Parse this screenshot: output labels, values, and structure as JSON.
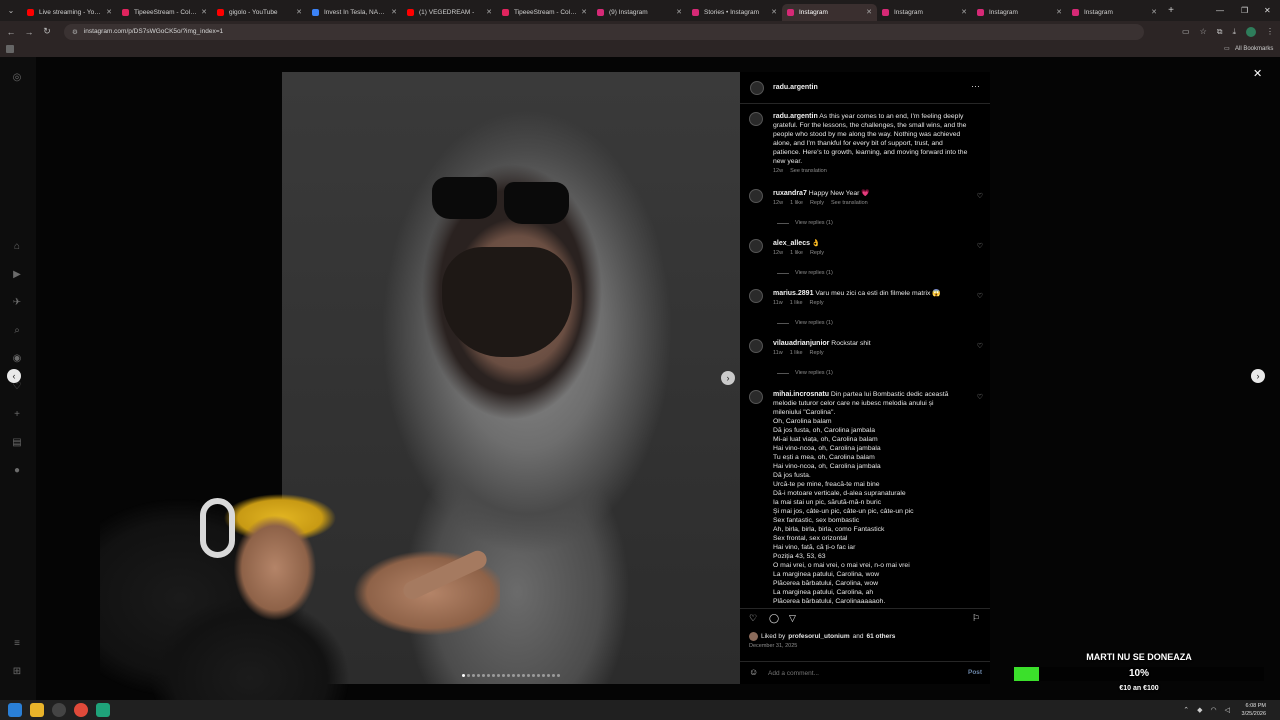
{
  "browser": {
    "tabs": [
      {
        "title": "Live streaming - YouTube",
        "color": "#ff0000",
        "active": false
      },
      {
        "title": "TipeeeStream - Collection",
        "color": "#e0245e",
        "active": false
      },
      {
        "title": "gigolo - YouTube",
        "color": "#ff0000",
        "active": false
      },
      {
        "title": "Invest In Tesla, NASDAQ",
        "color": "#3b82f6",
        "active": false
      },
      {
        "title": "(1) VEGEDREAM -",
        "color": "#ff0000",
        "active": false
      },
      {
        "title": "TipeeeStream - Collection",
        "color": "#e0245e",
        "active": false
      },
      {
        "title": "(9) Instagram",
        "color": "#d62976",
        "active": false
      },
      {
        "title": "Stories • Instagram",
        "color": "#d62976",
        "active": false
      },
      {
        "title": "Instagram",
        "color": "#d62976",
        "active": true
      },
      {
        "title": "Instagram",
        "color": "#d62976",
        "active": false
      },
      {
        "title": "Instagram",
        "color": "#d62976",
        "active": false
      },
      {
        "title": "Instagram",
        "color": "#d62976",
        "active": false
      }
    ],
    "url": "instagram.com/p/DS7sWGoCK5o/?img_index=1",
    "all_bookmarks": "All Bookmarks"
  },
  "post": {
    "author": "radu.argentin",
    "caption": "As this year comes to an end, I'm feeling deeply grateful. For the lessons, the challenges, the small wins, and the people who stood by me along the way. Nothing was achieved alone, and I'm thankful for every bit of support, trust, and patience. Here's to growth, learning, and moving forward into the new year.",
    "caption_time": "12w",
    "see_translation": "See translation",
    "liked_by_prefix": "Liked by",
    "liked_by_user": "profesorul_utonium",
    "liked_by_and": "and",
    "liked_by_others": "61 others",
    "date": "December 31, 2025",
    "add_comment_placeholder": "Add a comment...",
    "post_button": "Post"
  },
  "comments": [
    {
      "user": "ruxandra7",
      "text": "Happy New Year 💗",
      "time": "12w",
      "likes": "1 like",
      "reply": "Reply",
      "extra": "See translation",
      "view_replies": "View replies (1)"
    },
    {
      "user": "alex_allecs",
      "text": "👌",
      "time": "12w",
      "likes": "1 like",
      "reply": "Reply",
      "extra": "",
      "view_replies": "View replies (1)"
    },
    {
      "user": "marius.2891",
      "text": "Varu meu zici ca esti din filmele matrix 😱",
      "time": "11w",
      "likes": "1 like",
      "reply": "Reply",
      "extra": "",
      "view_replies": "View replies (1)"
    },
    {
      "user": "vilauadrianjunior",
      "text": "Rockstar shit",
      "time": "11w",
      "likes": "1 like",
      "reply": "Reply",
      "extra": "",
      "view_replies": "View replies (1)"
    }
  ],
  "long_comment": {
    "user": "mihai.incrosnatu",
    "lines": [
      "Din partea lui Bombastic dedic această",
      "melodie tuturor celor care ne iubesc melodia anului și",
      "mileniului \"Carolina\".",
      "Oh, Carolina balam",
      "Dă jos fusta, oh, Carolina jambala",
      "Mi-ai luat viața, oh, Carolina balam",
      "Hai vino-ncoa, oh, Carolina jambala",
      "Tu ești a mea, oh, Carolina balam",
      "Hai vino-ncoa, oh, Carolina jambala",
      "Dă jos fusta.",
      "Urcă-te pe mine, freacă-te mai bine",
      "Dă-i motoare verticale, d-alea supranaturale",
      "Ia mai stai un pic, sărută-mă-n buric",
      "Și mai jos, câte-un pic, câte-un pic, câte-un pic",
      "Sex fantastic, sex bombastic",
      "Ah, birla, birla, birla, como Fantastick",
      "Sex frontal, sex orizontal",
      "Hai vino, fată, că ți-o fac iar",
      "Poziția 43, 53, 63",
      "O mai vrei, o mai vrei, o mai vrei, n-o mai vrei",
      "La marginea patului, Carolina, wow",
      "Plăcerea bărbatului, Carolina, wow",
      "La marginea patului, Carolina, ah",
      "Plăcerea bărbatului, Carolinaaaaaoh."
    ]
  },
  "stream_goal": {
    "title": "MARTI NU SE DONEAZA",
    "percent_label": "10%",
    "progress": 0.1,
    "subtitle": "€10 an €100",
    "bar_color": "#3be02b"
  },
  "taskbar": {
    "time": "6:08 PM",
    "date": "3/25/2026"
  }
}
